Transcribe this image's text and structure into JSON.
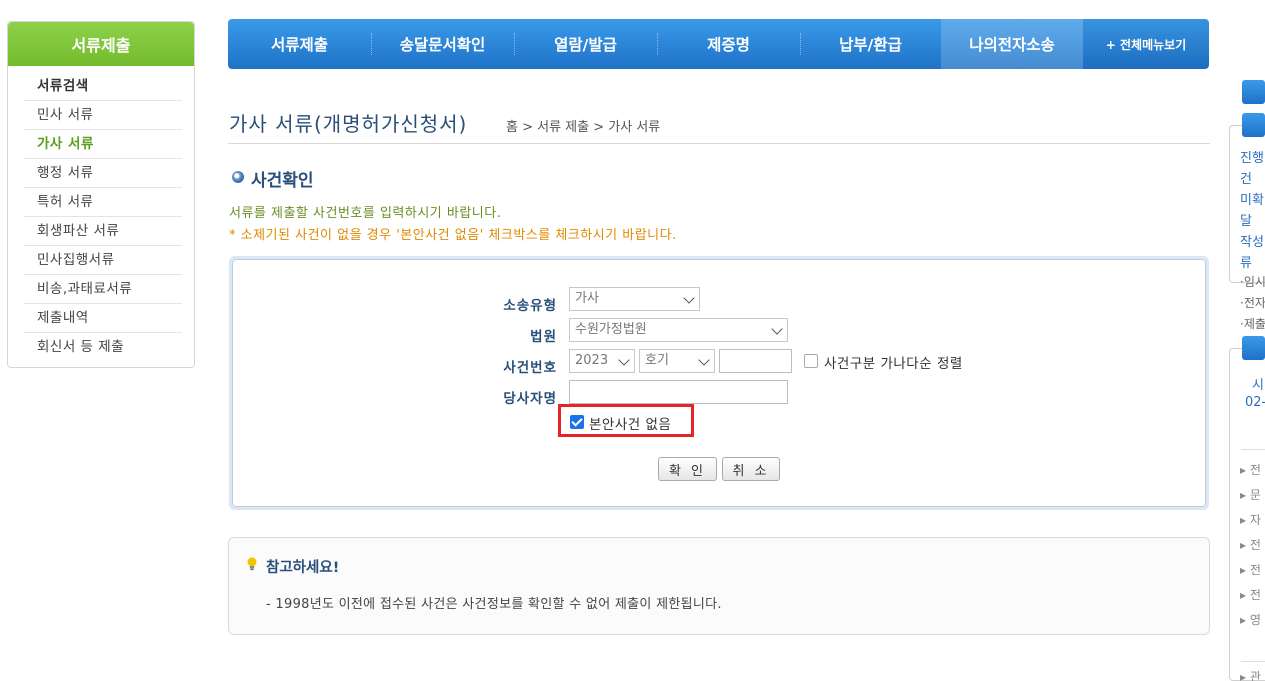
{
  "sidebar": {
    "title": "서류제출",
    "items": [
      {
        "label": "서류검색"
      },
      {
        "label": "민사 서류"
      },
      {
        "label": "가사 서류"
      },
      {
        "label": "행정 서류"
      },
      {
        "label": "특허 서류"
      },
      {
        "label": "회생파산 서류"
      },
      {
        "label": "민사집행서류"
      },
      {
        "label": "비송,과태료서류"
      },
      {
        "label": "제출내역"
      },
      {
        "label": "회신서 등 제출"
      }
    ]
  },
  "topnav": {
    "items": [
      {
        "label": "서류제출"
      },
      {
        "label": "송달문서확인"
      },
      {
        "label": "열람/발급"
      },
      {
        "label": "제증명"
      },
      {
        "label": "납부/환급"
      },
      {
        "label": "나의전자소송"
      }
    ],
    "all_menu": "+ 전체메뉴보기"
  },
  "page": {
    "title": "가사 서류(개명허가신청서)",
    "breadcrumb": "홈 > 서류 제출 > 가사 서류",
    "section_title": "사건확인",
    "notice1": "서류를 제출할 사건번호를 입력하시기 바랍니다.",
    "notice2": "* 소제기된 사건이 없을 경우 '본안사건 없음' 체크박스를 체크하시기 바랍니다."
  },
  "form": {
    "case_type_label": "소송유형",
    "case_type_value": "가사",
    "court_label": "법원",
    "court_value": "수원가정법원",
    "case_no_label": "사건번호",
    "year_value": "2023",
    "case_code_value": "호기",
    "case_number_value": "",
    "sort_label": "사건구분 가나다순 정렬",
    "party_label": "당사자명",
    "party_value": "",
    "no_case_label": "본안사건 없음",
    "no_case_checked": true,
    "confirm_label": "확 인",
    "cancel_label": "취 소"
  },
  "reference": {
    "title": "참고하세요!",
    "text": "- 1998년도 이전에 접수된 사건은 사건정보를 확인할 수 없어 제출이 제한됩니다."
  },
  "right_rail": {
    "box1_lines": [
      "진행",
      "건",
      "미확",
      "달",
      "작성",
      "류"
    ],
    "gray_lines": [
      "·임시",
      "·전자",
      "·제출"
    ],
    "box2_lines": [
      "시",
      "02-"
    ],
    "arrow_lines": [
      "전",
      "문",
      "자",
      "전",
      "전",
      "전",
      "영",
      "관"
    ]
  },
  "colors": {
    "nav_blue": "#1e72c8",
    "sidebar_green": "#74bb2f",
    "highlight_red": "#e5232b",
    "title_navy": "#2a4f7a",
    "notice_orange": "#e08a00",
    "notice_green": "#6b8e23"
  }
}
